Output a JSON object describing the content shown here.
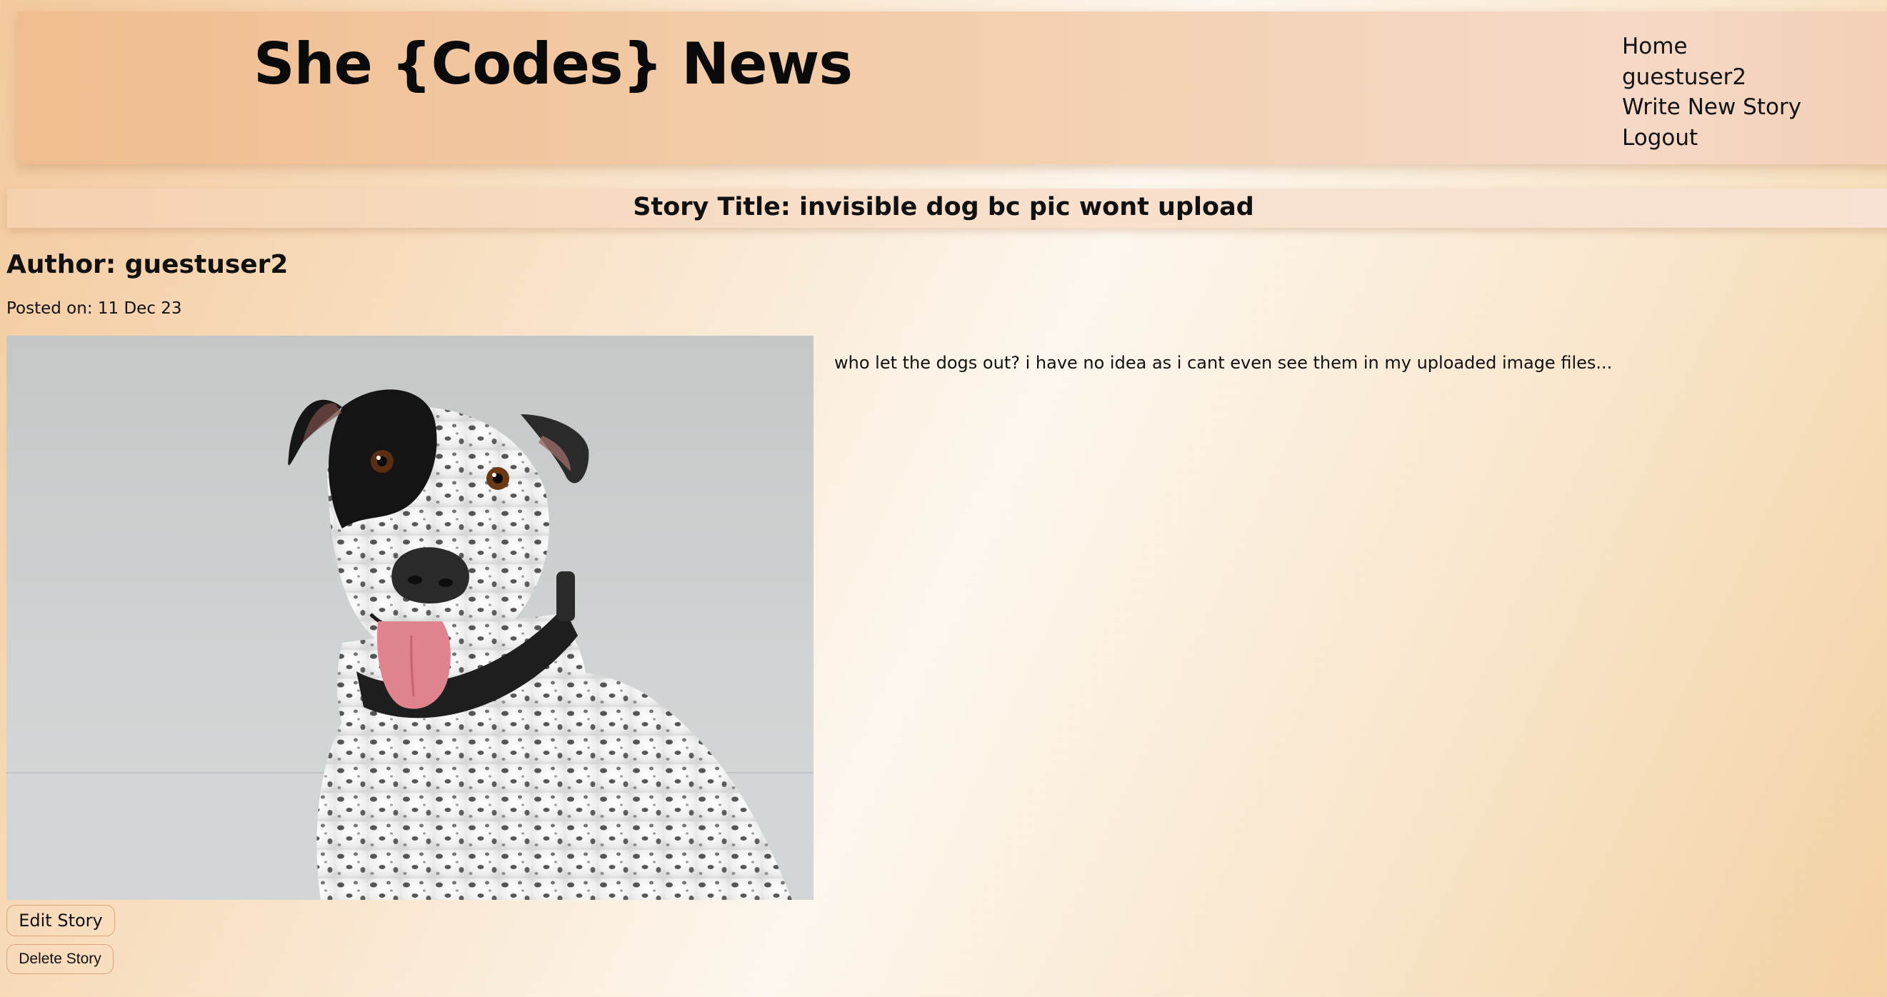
{
  "header": {
    "site_title": "She {Codes} News",
    "nav": [
      {
        "label": "Home"
      },
      {
        "label": "guestuser2"
      },
      {
        "label": "Write New Story"
      },
      {
        "label": "Logout"
      }
    ]
  },
  "story": {
    "title": "Story Title: invisible dog bc pic wont upload",
    "author": "Author: guestuser2",
    "posted": "Posted on: 11 Dec 23",
    "image_icon": "dog-photo",
    "body": "who let the dogs out? i have no idea as i cant even see them in my uploaded image files...",
    "edit_label": "Edit Story",
    "delete_label": "Delete Story"
  },
  "colors": {
    "header_bg": "#f0bd8f",
    "button_border": "#e0a47a",
    "page_accent": "#f3c99c"
  }
}
